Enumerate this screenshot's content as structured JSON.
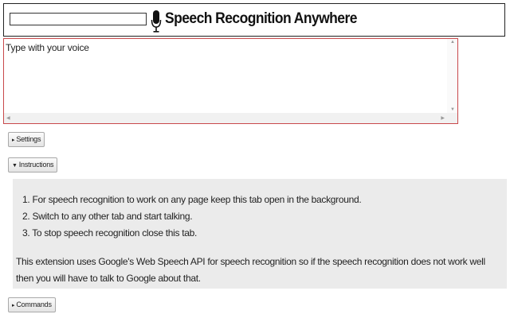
{
  "header": {
    "input_value": "",
    "title": "Speech Recognition Anywhere",
    "mic_icon": "microphone-icon"
  },
  "editor": {
    "placeholder": "Type with your voice",
    "text": "Type with your voice"
  },
  "buttons": {
    "settings": {
      "arrow": "▸",
      "label": "Settings"
    },
    "instructions": {
      "arrow": "▼",
      "label": "Instructions"
    },
    "commands": {
      "arrow": "▸",
      "label": "Commands"
    }
  },
  "instructions": {
    "steps": [
      "1. For speech recognition to work on any page keep this tab open in the background.",
      "2. Switch to any other tab and start talking.",
      "3. To stop speech recognition close this tab."
    ],
    "note": "This extension uses Google's Web Speech API for speech recognition so if the speech recognition does not work well then you will have to talk to Google about that."
  },
  "colors": {
    "editor_border": "#c8494b",
    "panel_background": "#ebebeb"
  }
}
